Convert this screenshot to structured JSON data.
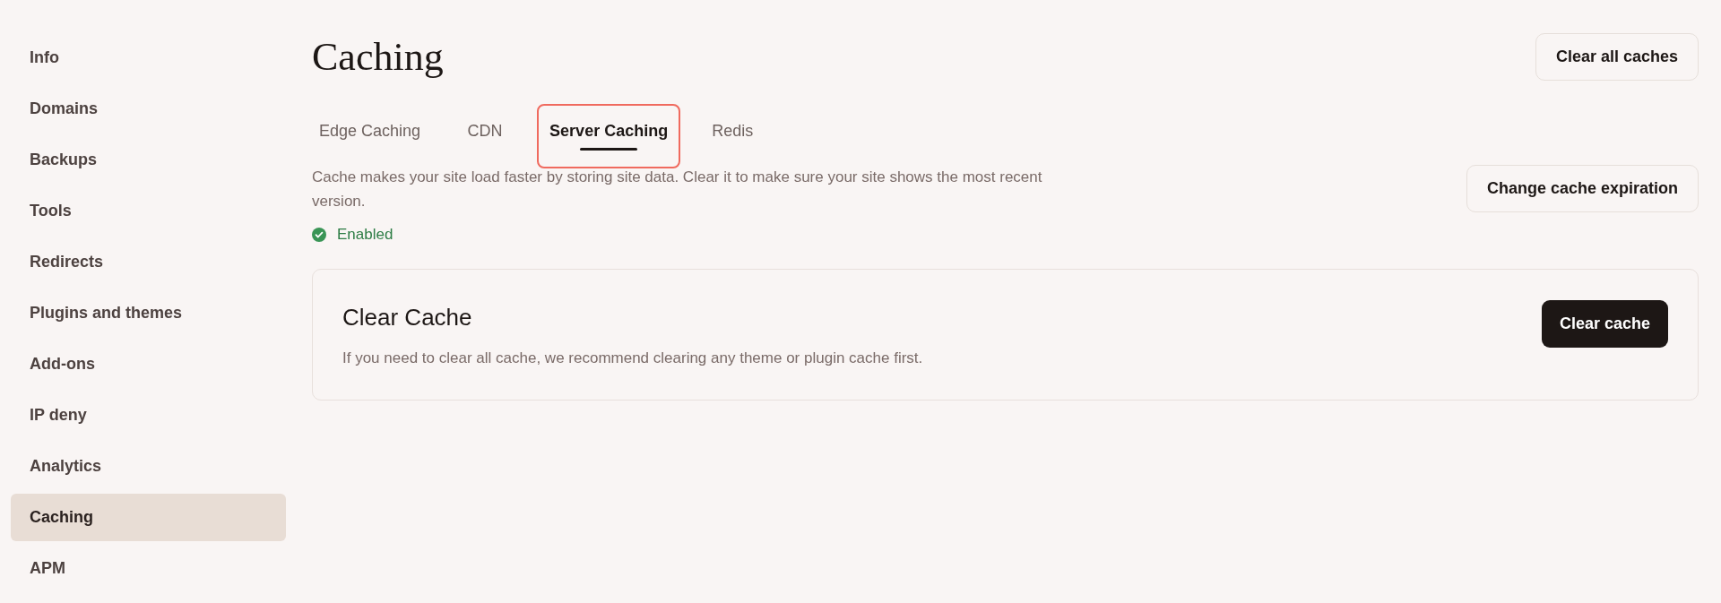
{
  "sidebar": {
    "items": [
      {
        "label": "Info",
        "selected": false
      },
      {
        "label": "Domains",
        "selected": false
      },
      {
        "label": "Backups",
        "selected": false
      },
      {
        "label": "Tools",
        "selected": false
      },
      {
        "label": "Redirects",
        "selected": false
      },
      {
        "label": "Plugins and themes",
        "selected": false
      },
      {
        "label": "Add-ons",
        "selected": false
      },
      {
        "label": "IP deny",
        "selected": false
      },
      {
        "label": "Analytics",
        "selected": false
      },
      {
        "label": "Caching",
        "selected": true
      },
      {
        "label": "APM",
        "selected": false
      }
    ]
  },
  "page": {
    "title": "Caching",
    "header_button": "Clear all caches"
  },
  "tabs": [
    {
      "label": "Edge Caching",
      "selected": false,
      "highlighted": false
    },
    {
      "label": "CDN",
      "selected": false,
      "highlighted": false
    },
    {
      "label": "Server Caching",
      "selected": true,
      "highlighted": true
    },
    {
      "label": "Redis",
      "selected": false,
      "highlighted": false
    }
  ],
  "description": "Cache makes your site load faster by storing site data. Clear it to make sure your site shows the most recent version.",
  "expiration_button": "Change cache expiration",
  "status": {
    "label": "Enabled",
    "enabled": true
  },
  "card": {
    "title": "Clear Cache",
    "text": "If you need to clear all cache, we recommend clearing any theme or plugin cache first.",
    "button": "Clear cache"
  }
}
